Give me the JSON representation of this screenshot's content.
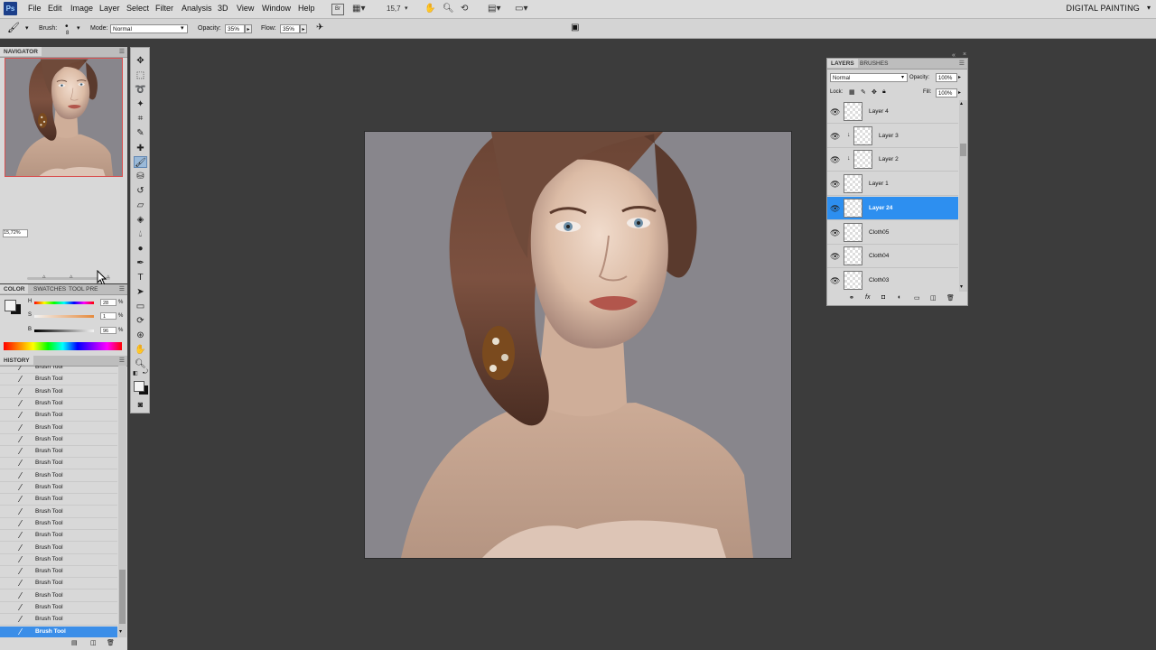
{
  "app": {
    "logo": "Ps",
    "menus": [
      "File",
      "Edit",
      "Image",
      "Layer",
      "Select",
      "Filter",
      "Analysis",
      "3D",
      "View",
      "Window",
      "Help"
    ],
    "zoom_display": "15,7",
    "workspace": "DIGITAL PAINTING"
  },
  "options": {
    "brush_label": "Brush:",
    "brush_size": "8",
    "mode_label": "Mode:",
    "mode_value": "Normal",
    "opacity_label": "Opacity:",
    "opacity_value": "35%",
    "flow_label": "Flow:",
    "flow_value": "35%"
  },
  "navigator": {
    "title": "NAVIGATOR",
    "zoom": "15,72%"
  },
  "color_panel": {
    "tabs": [
      "COLOR",
      "SWATCHES",
      "TOOL PRE"
    ],
    "h_label": "H",
    "h_value": "28",
    "s_label": "S",
    "s_value": "1",
    "b_label": "B",
    "b_value": "96",
    "percent": "%",
    "foreground": "#f4f4f4",
    "background": "#111111"
  },
  "history": {
    "title": "HISTORY",
    "items": [
      "Brush Tool",
      "Brush Tool",
      "Brush Tool",
      "Brush Tool",
      "Brush Tool",
      "Brush Tool",
      "Brush Tool",
      "Brush Tool",
      "Brush Tool",
      "Brush Tool",
      "Brush Tool",
      "Brush Tool",
      "Brush Tool",
      "Brush Tool",
      "Brush Tool",
      "Brush Tool",
      "Brush Tool",
      "Brush Tool",
      "Brush Tool",
      "Brush Tool",
      "Brush Tool",
      "Brush Tool",
      "Brush Tool"
    ],
    "active_index": 22
  },
  "layers_panel": {
    "tabs": [
      "LAYERS",
      "BRUSHES"
    ],
    "blend_mode": "Normal",
    "opacity_label": "Opacity:",
    "opacity_value": "100%",
    "lock_label": "Lock:",
    "fill_label": "Fill:",
    "fill_value": "100%",
    "layers": [
      {
        "name": "Layer 4",
        "clipped": false
      },
      {
        "name": "Layer 3",
        "clipped": true
      },
      {
        "name": "Layer 2",
        "clipped": true
      },
      {
        "name": "Layer 1",
        "clipped": false
      },
      {
        "name": "Layer 24",
        "clipped": false
      },
      {
        "name": "Cloth05",
        "clipped": false
      },
      {
        "name": "Cloth04",
        "clipped": false
      },
      {
        "name": "Cloth03",
        "clipped": false
      }
    ],
    "active_index": 4
  },
  "colors": {
    "selection": "#2d8ff0",
    "canvas_bg": "#88868c",
    "workspace_bg": "#3c3c3c"
  }
}
